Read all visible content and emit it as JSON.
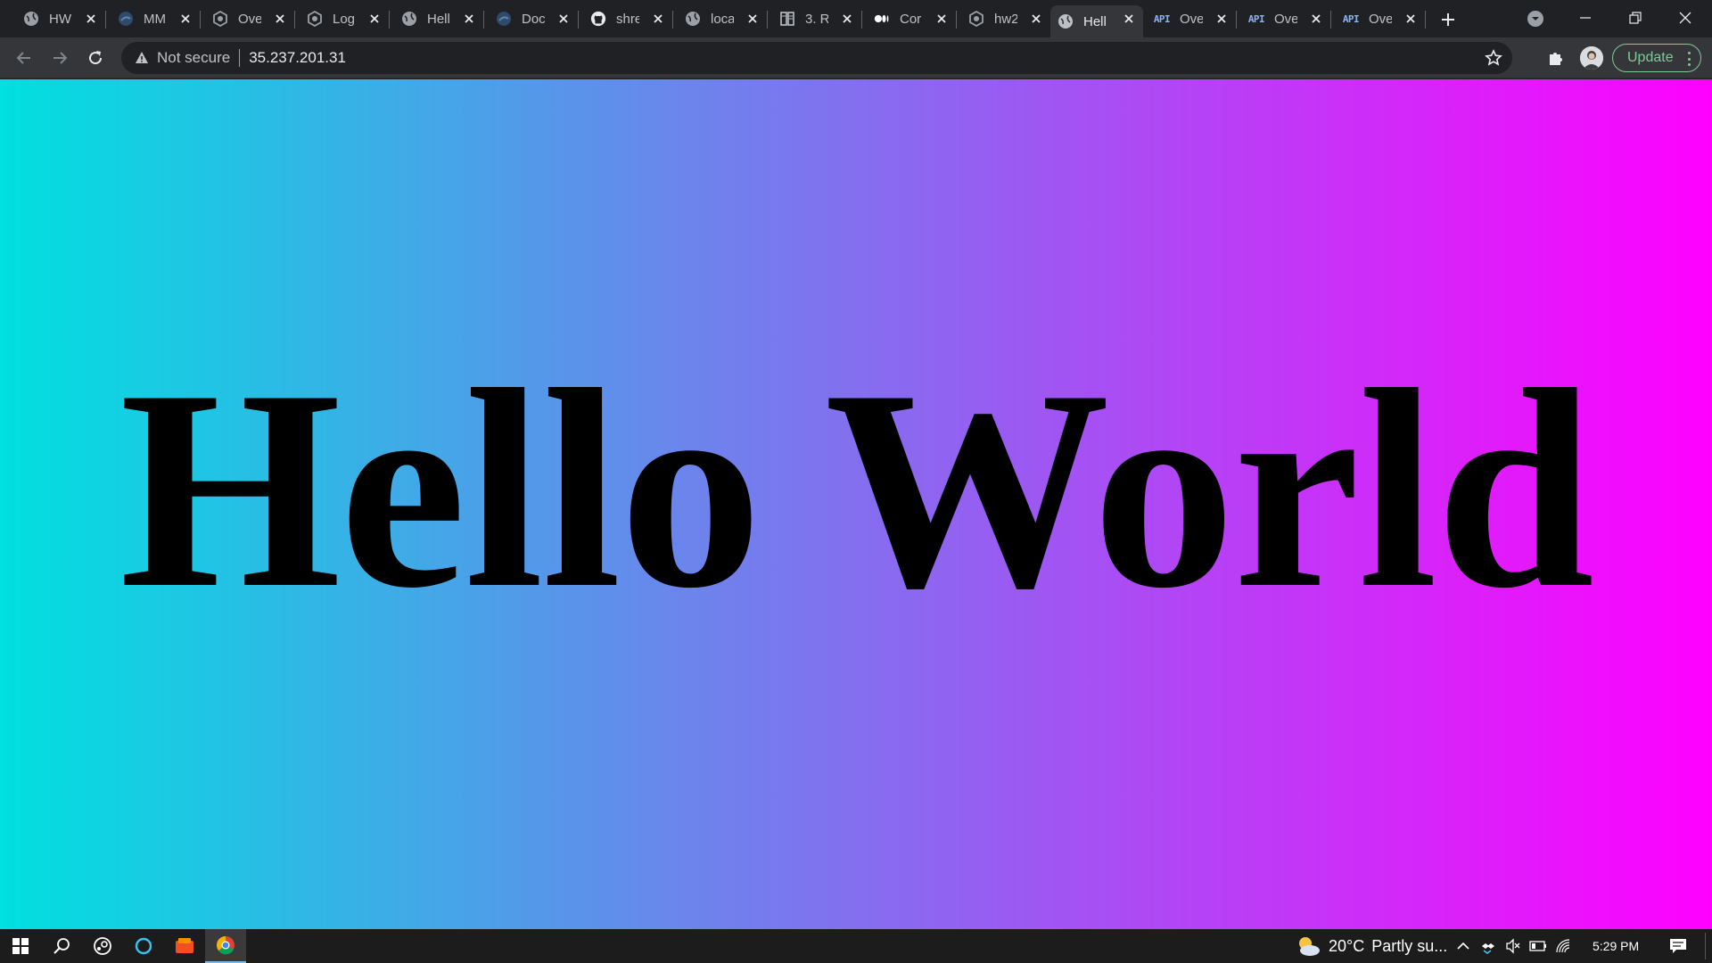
{
  "browser": {
    "tabs": [
      {
        "title": "HW",
        "icon": "globe-icon"
      },
      {
        "title": "MM",
        "icon": "site-icon"
      },
      {
        "title": "Ove",
        "icon": "gear-site-icon"
      },
      {
        "title": "Log",
        "icon": "gear-site-icon"
      },
      {
        "title": "Hell",
        "icon": "globe-icon"
      },
      {
        "title": "Doc",
        "icon": "site-icon"
      },
      {
        "title": "shre",
        "icon": "github-icon"
      },
      {
        "title": "loca",
        "icon": "globe-icon"
      },
      {
        "title": "3. R",
        "icon": "book-icon"
      },
      {
        "title": "Cor",
        "icon": "medium-icon"
      },
      {
        "title": "hw2",
        "icon": "gear-site-icon"
      },
      {
        "title": "Hell",
        "icon": "globe-icon",
        "active": true
      },
      {
        "title": "Ove",
        "icon": "api-icon",
        "badge": "API"
      },
      {
        "title": "Ove",
        "icon": "api-icon",
        "badge": "API"
      },
      {
        "title": "Ove",
        "icon": "api-icon",
        "badge": "API"
      }
    ],
    "omnibox": {
      "security_label": "Not secure",
      "url": "35.237.201.31"
    },
    "update_label": "Update"
  },
  "page": {
    "headline": "Hello World",
    "gradient": [
      "#00e0e0",
      "#6b85ec",
      "#ff00ff"
    ]
  },
  "taskbar": {
    "weather": {
      "temp": "20°C",
      "condition": "Partly su..."
    },
    "clock": "5:29 PM"
  },
  "colors": {
    "chrome_dark": "#202124",
    "toolbar": "#35363a",
    "update_green": "#81c995",
    "taskbar": "#1c1c1c"
  }
}
